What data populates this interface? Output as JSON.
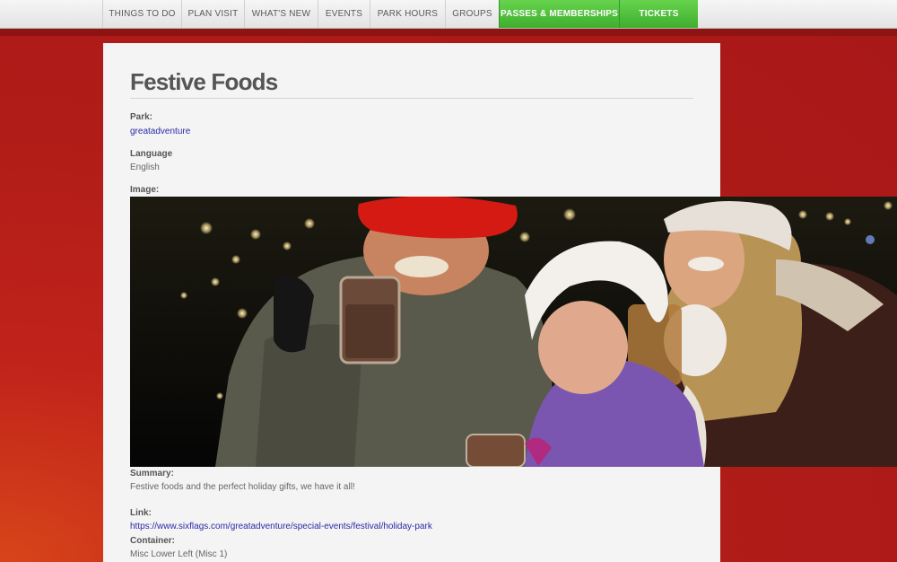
{
  "nav": {
    "items": [
      {
        "label": "THINGS TO DO"
      },
      {
        "label": "PLAN VISIT"
      },
      {
        "label": "WHAT'S NEW"
      },
      {
        "label": "EVENTS"
      },
      {
        "label": "PARK HOURS"
      },
      {
        "label": "GROUPS"
      },
      {
        "label": "PASSES & MEMBERSHIPS"
      },
      {
        "label": "TICKETS"
      }
    ],
    "accent_color": "#4fc23a"
  },
  "page": {
    "title": "Festive Foods",
    "background_color": "#b01c18",
    "fields": {
      "park_label": "Park:",
      "park_value": "greatadventure",
      "language_label": "Language",
      "language_value": "English",
      "image_label": "Image:",
      "summary_label": "Summary:",
      "summary_value": "Festive foods and the perfect holiday gifts, we have it all!",
      "link_label": "Link:",
      "link_value": "https://www.sixflags.com/greatadventure/special-events/festival/holiday-park",
      "container_label": "Container:",
      "container_value": "Misc Lower Left (Misc 1)"
    },
    "image_icon": "family-holiday-photo"
  }
}
